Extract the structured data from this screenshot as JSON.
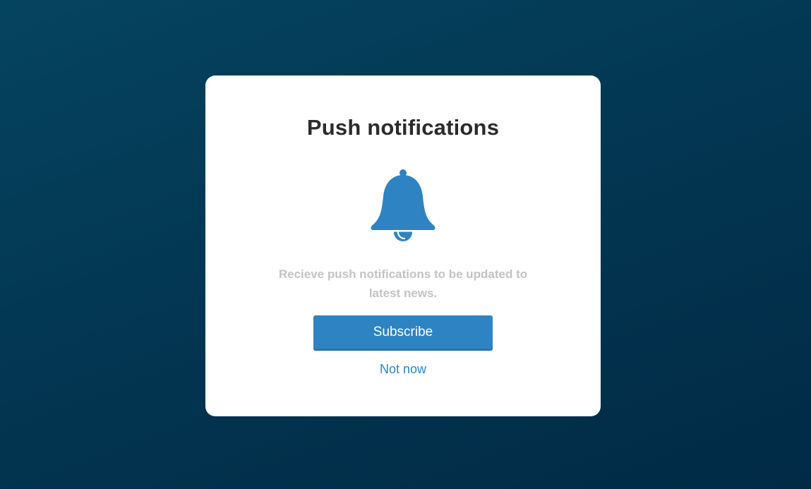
{
  "dialog": {
    "title": "Push notifications",
    "icon": "bell-icon",
    "message": "Recieve push notifications to be updated to latest news.",
    "subscribe_label": "Subscribe",
    "dismiss_label": "Not now"
  },
  "colors": {
    "accent": "#2e83c2",
    "title": "#2b2b2b",
    "message": "#c3c3c3",
    "background_start": "#05445f",
    "background_end": "#012a45"
  }
}
